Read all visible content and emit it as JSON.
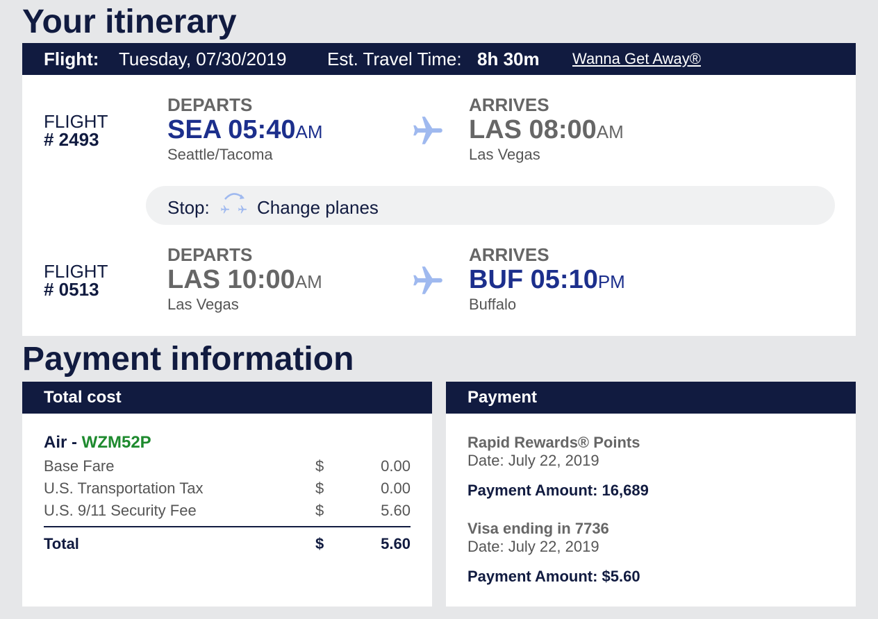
{
  "itinerary": {
    "title": "Your itinerary",
    "bar": {
      "flight_label": "Flight:",
      "date": "Tuesday, 07/30/2019",
      "travel_label": "Est. Travel Time:",
      "travel_value": "8h 30m",
      "fare_link": "Wanna Get Away®"
    },
    "flights": [
      {
        "flight_label": "FLIGHT",
        "flight_number": "# 2493",
        "departs_label": "DEPARTS",
        "departs_code_time": "SEA 05:40",
        "departs_ampm": "AM",
        "departs_city": "Seattle/Tacoma",
        "arrives_label": "ARRIVES",
        "arrives_code_time": "LAS 08:00",
        "arrives_ampm": "AM",
        "arrives_city": "Las Vegas"
      },
      {
        "flight_label": "FLIGHT",
        "flight_number": "# 0513",
        "departs_label": "DEPARTS",
        "departs_code_time": "LAS 10:00",
        "departs_ampm": "AM",
        "departs_city": "Las Vegas",
        "arrives_label": "ARRIVES",
        "arrives_code_time": "BUF 05:10",
        "arrives_ampm": "PM",
        "arrives_city": "Buffalo"
      }
    ],
    "stop": {
      "label": "Stop:",
      "text": "Change planes",
      "icon": "change-planes-icon"
    }
  },
  "payment": {
    "title": "Payment information",
    "total_cost": {
      "header": "Total cost",
      "air_label": "Air - ",
      "confirmation": "WZM52P",
      "rows": [
        {
          "label": "Base Fare",
          "currency": "$",
          "amount": "0.00"
        },
        {
          "label": "U.S. Transportation Tax",
          "currency": "$",
          "amount": "0.00"
        },
        {
          "label": "U.S. 9/11 Security Fee",
          "currency": "$",
          "amount": "5.60"
        }
      ],
      "total": {
        "label": "Total",
        "currency": "$",
        "amount": "5.60"
      }
    },
    "payment_box": {
      "header": "Payment",
      "methods": [
        {
          "name": "Rapid Rewards® Points",
          "date": "Date: July 22, 2019",
          "amount": "Payment Amount: 16,689"
        },
        {
          "name": "Visa ending in 7736",
          "date": "Date: July 22, 2019",
          "amount": "Payment Amount: $5.60"
        }
      ]
    }
  },
  "colors": {
    "navy": "#111b40",
    "blue": "#1c2f8c",
    "green": "#1e8a2e",
    "background": "#e6e7e9",
    "plane_icon": "#9fb9ef"
  }
}
